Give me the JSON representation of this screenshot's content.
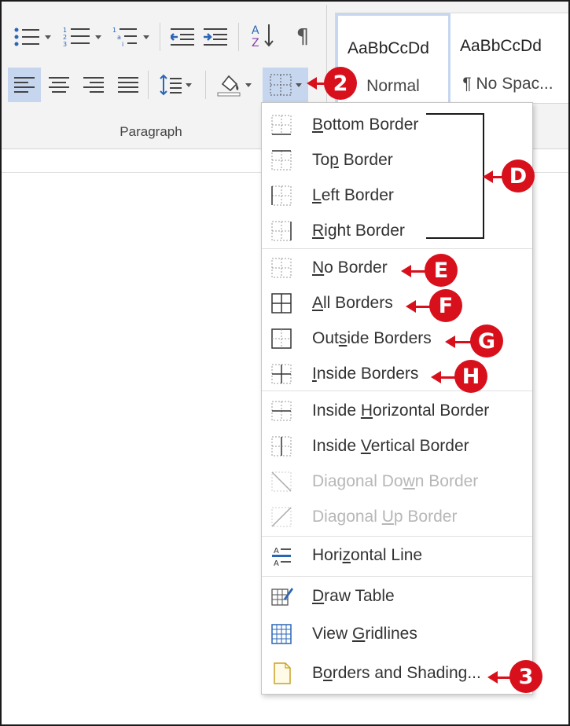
{
  "ribbon": {
    "group_label": "Paragraph",
    "styles": [
      {
        "sample": "AaBbCcDd",
        "name": "Normal"
      },
      {
        "sample": "AaBbCcDd",
        "name": "¶ No Spac..."
      }
    ]
  },
  "menu": {
    "items": [
      {
        "label_pre": "",
        "key": "B",
        "label_post": "ottom Border",
        "icon": "bottom-border-icon",
        "disabled": false
      },
      {
        "label_pre": "To",
        "key": "p",
        "label_post": " Border",
        "icon": "top-border-icon",
        "disabled": false
      },
      {
        "label_pre": "",
        "key": "L",
        "label_post": "eft Border",
        "icon": "left-border-icon",
        "disabled": false
      },
      {
        "label_pre": "",
        "key": "R",
        "label_post": "ight Border",
        "icon": "right-border-icon",
        "disabled": false
      },
      {
        "label_pre": "",
        "key": "N",
        "label_post": "o Border",
        "icon": "no-border-icon",
        "disabled": false
      },
      {
        "label_pre": "",
        "key": "A",
        "label_post": "ll Borders",
        "icon": "all-borders-icon",
        "disabled": false
      },
      {
        "label_pre": "Out",
        "key": "s",
        "label_post": "ide Borders",
        "icon": "outside-borders-icon",
        "disabled": false
      },
      {
        "label_pre": "",
        "key": "I",
        "label_post": "nside Borders",
        "icon": "inside-borders-icon",
        "disabled": false
      },
      {
        "label_pre": "Inside ",
        "key": "H",
        "label_post": "orizontal Border",
        "icon": "inside-horizontal-border-icon",
        "disabled": false
      },
      {
        "label_pre": "Inside ",
        "key": "V",
        "label_post": "ertical Border",
        "icon": "inside-vertical-border-icon",
        "disabled": false
      },
      {
        "label_pre": "Diagonal Do",
        "key": "w",
        "label_post": "n Border",
        "icon": "diagonal-down-border-icon",
        "disabled": true
      },
      {
        "label_pre": "Diagonal ",
        "key": "U",
        "label_post": "p Border",
        "icon": "diagonal-up-border-icon",
        "disabled": true
      },
      {
        "label_pre": "Hori",
        "key": "z",
        "label_post": "ontal Line",
        "icon": "horizontal-line-icon",
        "disabled": false
      },
      {
        "label_pre": "",
        "key": "D",
        "label_post": "raw Table",
        "icon": "draw-table-icon",
        "disabled": false
      },
      {
        "label_pre": "View ",
        "key": "G",
        "label_post": "ridlines",
        "icon": "view-gridlines-icon",
        "disabled": false
      },
      {
        "label_pre": "B",
        "key": "o",
        "label_post": "rders and Shading...",
        "icon": "borders-and-shading-icon",
        "disabled": false
      }
    ]
  },
  "callouts": {
    "c2": "2",
    "cD": "D",
    "cE": "E",
    "cF": "F",
    "cG": "G",
    "cH": "H",
    "c3": "3"
  },
  "colors": {
    "callout": "#d8101c",
    "active_button": "#c5d6ee"
  }
}
